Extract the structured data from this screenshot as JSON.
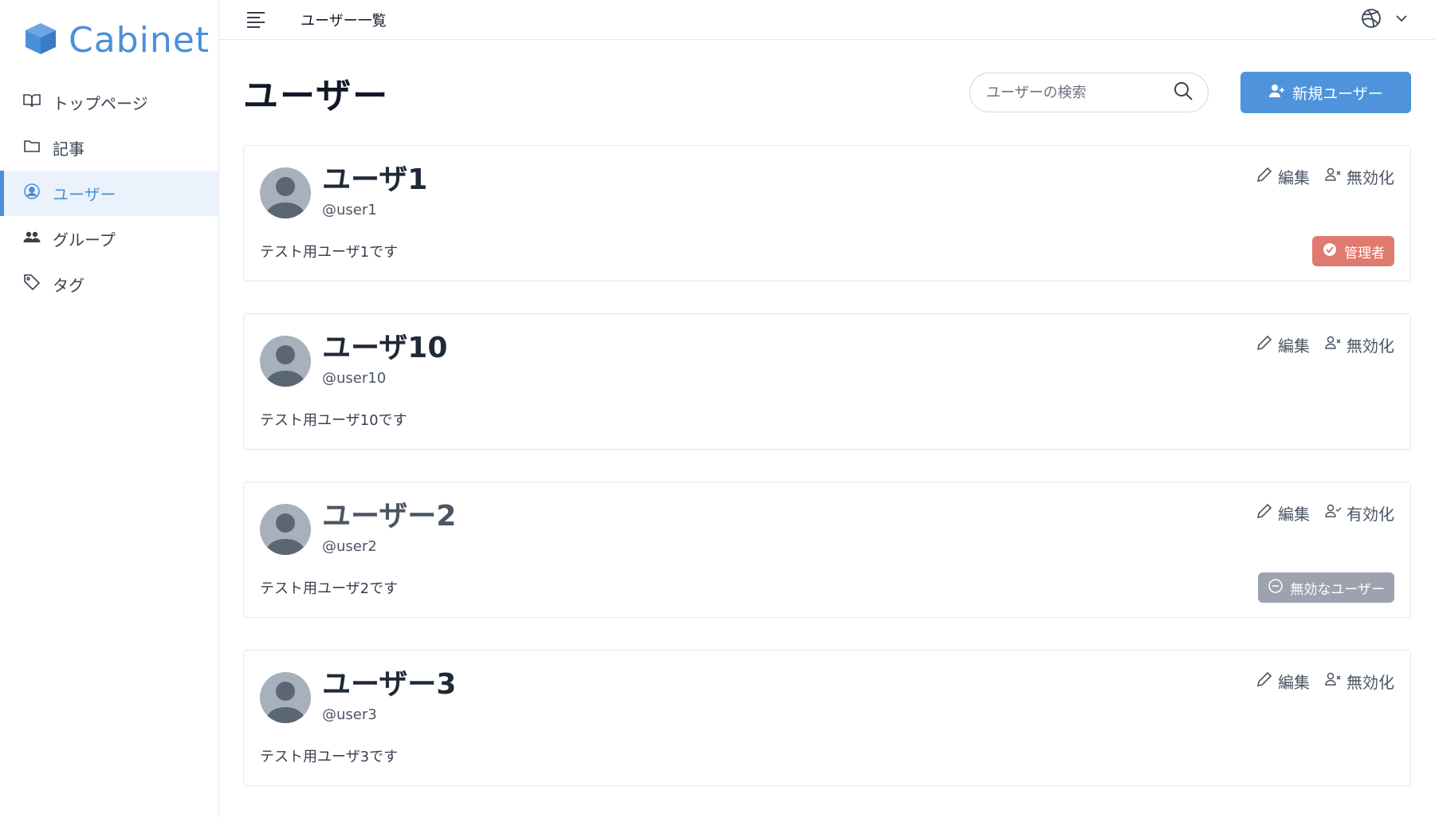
{
  "brand": {
    "name": "Cabinet",
    "color": "#4a90d9"
  },
  "sidebar": {
    "items": [
      {
        "label": "トップページ",
        "icon": "book-icon",
        "active": false
      },
      {
        "label": "記事",
        "icon": "folder-icon",
        "active": false
      },
      {
        "label": "ユーザー",
        "icon": "user-circle-icon",
        "active": true
      },
      {
        "label": "グループ",
        "icon": "users-icon",
        "active": false
      },
      {
        "label": "タグ",
        "icon": "tag-icon",
        "active": false
      }
    ]
  },
  "topbar": {
    "title": "ユーザー一覧"
  },
  "page": {
    "title": "ユーザー",
    "search_placeholder": "ユーザーの検索",
    "new_user_label": "新規ユーザー"
  },
  "actions": {
    "edit": "編集",
    "disable": "無効化",
    "enable": "有効化"
  },
  "users": [
    {
      "name": "ユーザ1",
      "handle": "@user1",
      "desc": "テスト用ユーザ1です",
      "toggle": "無効化",
      "badge": "管理者",
      "badge_type": "admin",
      "inactive": false
    },
    {
      "name": "ユーザ10",
      "handle": "@user10",
      "desc": "テスト用ユーザ10です",
      "toggle": "無効化",
      "badge": "",
      "badge_type": "",
      "inactive": false
    },
    {
      "name": "ユーザー2",
      "handle": "@user2",
      "desc": "テスト用ユーザ2です",
      "toggle": "有効化",
      "badge": "無効なユーザー",
      "badge_type": "disabled",
      "inactive": true
    },
    {
      "name": "ユーザー3",
      "handle": "@user3",
      "desc": "テスト用ユーザ3です",
      "toggle": "無効化",
      "badge": "",
      "badge_type": "",
      "inactive": false
    }
  ],
  "colors": {
    "accent": "#4f93dd",
    "admin_badge": "#e07a6e",
    "disabled_badge": "#9ca3af",
    "active_nav_bg": "#ebf2fb"
  }
}
